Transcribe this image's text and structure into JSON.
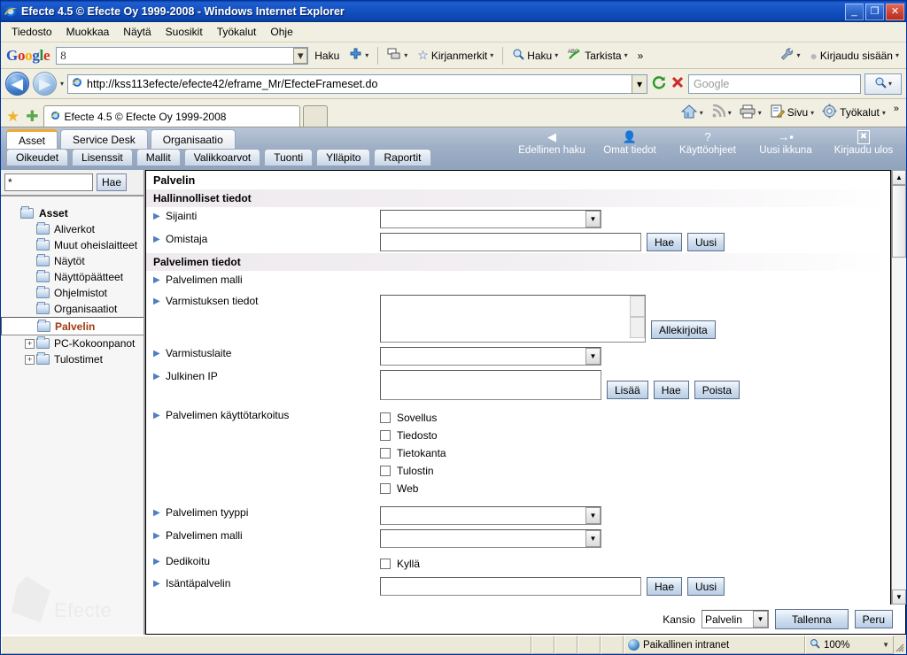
{
  "window": {
    "title": "Efecte 4.5 © Efecte Oy 1999-2008 - Windows Internet Explorer",
    "minimize_label": "_",
    "restore_label": "❐",
    "close_label": "✕"
  },
  "menubar": {
    "items": [
      {
        "label": "Tiedosto"
      },
      {
        "label": "Muokkaa"
      },
      {
        "label": "Näytä"
      },
      {
        "label": "Suosikit"
      },
      {
        "label": "Työkalut"
      },
      {
        "label": "Ohje"
      }
    ]
  },
  "google_toolbar": {
    "logo": [
      "G",
      "o",
      "o",
      "g",
      "l",
      "e"
    ],
    "search_value": "8",
    "search_label": "Haku",
    "plus_label": "",
    "bookmarks_label": "Kirjanmerkit",
    "find_label": "Haku",
    "check_label": "Tarkista",
    "overflow_label": "»",
    "wrench_label": "",
    "signin_label": "Kirjaudu sisään"
  },
  "address_bar": {
    "back_label": "◀",
    "forward_label": "▶",
    "url": "http://kss113efecte/efecte42/eframe_Mr/EfecteFrameset.do",
    "search_placeholder": "Google",
    "go_label": "🔍"
  },
  "tab_bar": {
    "favorites_star": "★",
    "add_favorite": "✚",
    "tab_title": "Efecte 4.5 © Efecte Oy 1999-2008",
    "home_label": "",
    "feeds_label": "",
    "print_label": "",
    "page_label": "Sivu",
    "tools_label": "Työkalut",
    "overflow_label": "»"
  },
  "efecte": {
    "main_tabs": [
      {
        "label": "Asset",
        "active": true
      },
      {
        "label": "Service Desk",
        "active": false
      },
      {
        "label": "Organisaatio",
        "active": false
      }
    ],
    "sub_tabs": [
      {
        "label": "Oikeudet"
      },
      {
        "label": "Lisenssit"
      },
      {
        "label": "Mallit"
      },
      {
        "label": "Valikkoarvot"
      },
      {
        "label": "Tuonti"
      },
      {
        "label": "Ylläpito"
      },
      {
        "label": "Raportit"
      }
    ],
    "toolbar_icons": [
      {
        "glyph": "◀",
        "label": "Edellinen haku",
        "name": "previous-search"
      },
      {
        "glyph": "👤",
        "label": "Omat tiedot",
        "name": "my-details"
      },
      {
        "glyph": "?",
        "label": "Käyttöohjeet",
        "name": "help"
      },
      {
        "glyph": "→▪",
        "label": "Uusi ikkuna",
        "name": "new-window"
      },
      {
        "glyph": "✖",
        "label": "Kirjaudu ulos",
        "name": "logout"
      }
    ],
    "sidebar": {
      "search_value": "*",
      "search_button": "Hae",
      "root_label": "Asset",
      "items": [
        {
          "label": "Aliverkot",
          "selected": false,
          "expandable": false
        },
        {
          "label": "Muut oheislaitteet",
          "selected": false,
          "expandable": false
        },
        {
          "label": "Näytöt",
          "selected": false,
          "expandable": false
        },
        {
          "label": "Näyttöpäätteet",
          "selected": false,
          "expandable": false
        },
        {
          "label": "Ohjelmistot",
          "selected": false,
          "expandable": false
        },
        {
          "label": "Organisaatiot",
          "selected": false,
          "expandable": false
        },
        {
          "label": "Palvelin",
          "selected": true,
          "expandable": false
        },
        {
          "label": "PC-Kokoonpanot",
          "selected": false,
          "expandable": true,
          "expander": "+"
        },
        {
          "label": "Tulostimet",
          "selected": false,
          "expandable": true,
          "expander": "+"
        }
      ],
      "watermark_text": "Efecte"
    },
    "form": {
      "title": "Palvelin",
      "sections": [
        {
          "heading": "Hallinnolliset tiedot",
          "rows": [
            {
              "label": "Sijainti",
              "control": "select",
              "value": ""
            },
            {
              "label": "Omistaja",
              "control": "input-buttons",
              "value": "",
              "buttons": [
                "Hae",
                "Uusi"
              ]
            }
          ]
        },
        {
          "heading": "Palvelimen tiedot",
          "rows": [
            {
              "label": "Palvelimen malli",
              "control": "none",
              "value": ""
            },
            {
              "label": "Varmistuksen tiedot",
              "control": "textarea-button",
              "value": "",
              "buttons": [
                "Allekirjoita"
              ]
            },
            {
              "label": "Varmistuslaite",
              "control": "select",
              "value": ""
            },
            {
              "label": "Julkinen IP",
              "control": "textarea-buttons",
              "value": "",
              "buttons": [
                "Lisää",
                "Hae",
                "Poista"
              ]
            },
            {
              "label": "Palvelimen käyttötarkoitus",
              "control": "checkboxes",
              "options": [
                {
                  "label": "Sovellus",
                  "checked": false
                },
                {
                  "label": "Tiedosto",
                  "checked": false
                },
                {
                  "label": "Tietokanta",
                  "checked": false
                },
                {
                  "label": "Tulostin",
                  "checked": false
                },
                {
                  "label": "Web",
                  "checked": false
                }
              ]
            },
            {
              "label": "Palvelimen tyyppi",
              "control": "select",
              "value": ""
            },
            {
              "label": "Palvelimen malli",
              "control": "select",
              "value": ""
            },
            {
              "label": "Dedikoitu",
              "control": "checkbox",
              "options": [
                {
                  "label": "Kyllä",
                  "checked": false
                }
              ]
            },
            {
              "label": "Isäntäpalvelin",
              "control": "input-buttons",
              "value": "",
              "buttons": [
                "Hae",
                "Uusi"
              ]
            }
          ]
        }
      ],
      "footer": {
        "kansio_label": "Kansio",
        "kansio_value": "Palvelin",
        "save_label": "Tallenna",
        "cancel_label": "Peru"
      }
    }
  },
  "statusbar": {
    "message": "",
    "zone": "Paikallinen intranet",
    "zoom": "100%"
  }
}
